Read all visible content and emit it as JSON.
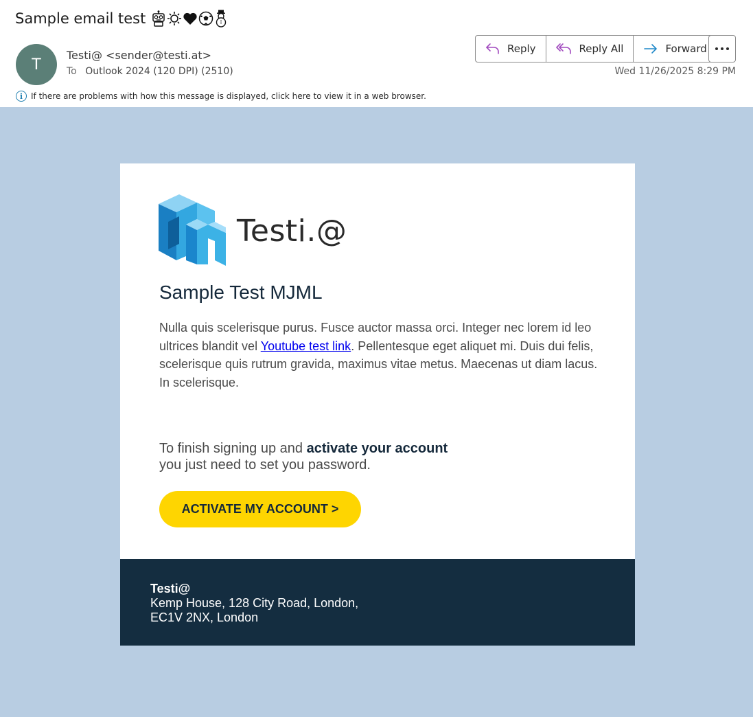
{
  "message": {
    "subject": "Sample email test",
    "subject_emojis": [
      "robot-emoji",
      "sun-emoji",
      "heart-emoji",
      "soccer-ball-emoji",
      "snowman-emoji"
    ],
    "sender_initial": "T",
    "sender_display": "Testi@ <sender@testi.at>",
    "to_label": "To",
    "recipient": "Outlook 2024 (120 DPI) (2510)",
    "date": "Wed 11/26/2025 8:29 PM",
    "info_bar": "If there are problems with how this message is displayed, click here to view it in a web browser."
  },
  "actions": {
    "reply": "Reply",
    "reply_all": "Reply All",
    "forward": "Forward",
    "more_icon": "ellipsis-icon"
  },
  "email": {
    "logo_text": "Testi.@",
    "title": "Sample Test MJML",
    "body_before_link": "Nulla quis scelerisque purus. Fusce auctor massa orci. Integer nec lorem id leo ultrices blandit vel ",
    "link_text": "Youtube test link",
    "body_after_link": ". Pellentesque eget aliquet mi. Duis dui felis, scelerisque quis rutrum gravida, maximus vitae metus. Maecenas ut diam lacus. In scelerisque.",
    "activate_prefix": "To finish signing up and ",
    "activate_bold": "activate your account",
    "activate_line2": "you just need to set you password.",
    "cta_label": "ACTIVATE MY ACCOUNT >",
    "footer_name": "Testi@",
    "footer_line1": "Kemp House, 128 City Road, London,",
    "footer_line2": "EC1V 2NX, London"
  },
  "colors": {
    "avatar": "#5b7f77",
    "canvas_bg": "#b8cde2",
    "cta_bg": "#fed501",
    "footer_bg": "#142d40",
    "heading": "#14283a",
    "link": "#0000ee",
    "reply_icon": "#a24bbf",
    "forward_icon": "#1f88c9"
  }
}
